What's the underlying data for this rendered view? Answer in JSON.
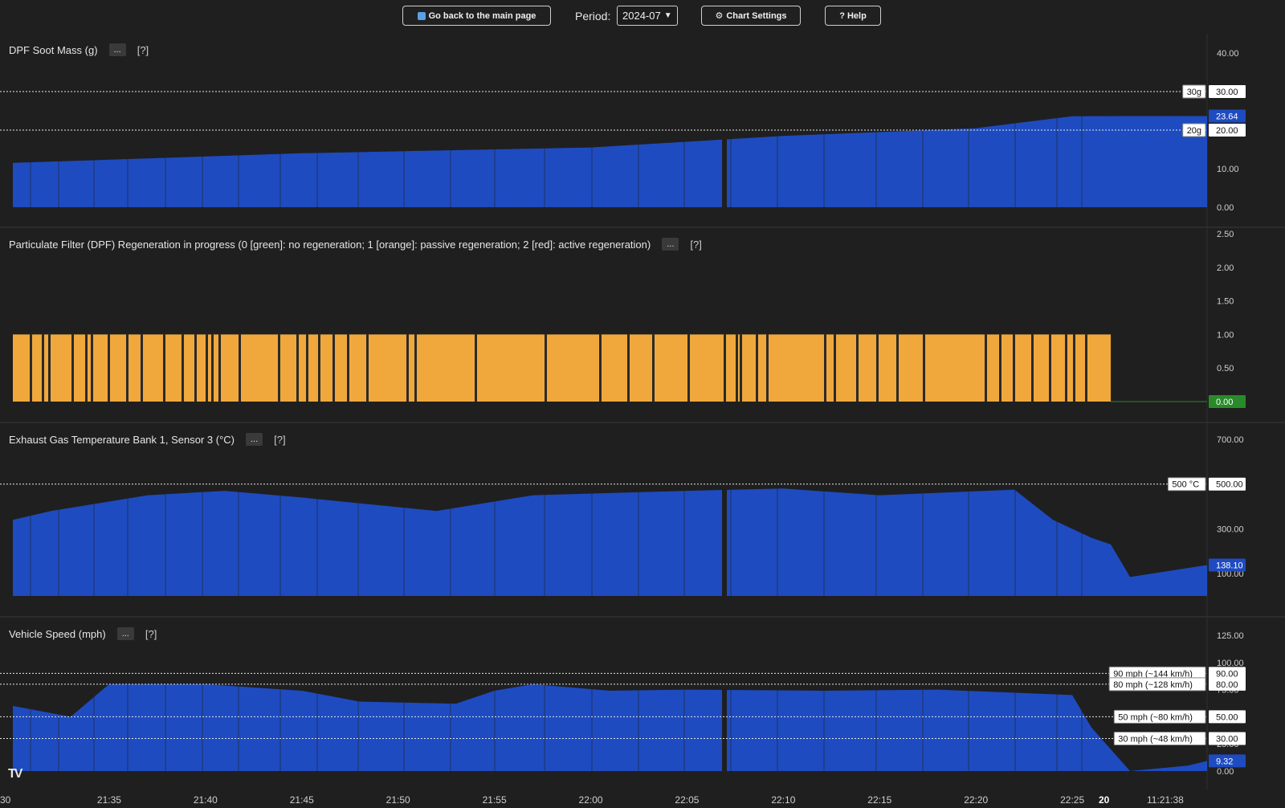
{
  "toolbar": {
    "back_label": "Go back to the main page",
    "period_label": "Period:",
    "period_value": "2024-07",
    "settings_label": "Chart Settings",
    "help_label": "? Help"
  },
  "panes": [
    {
      "title": "DPF Soot Mass (g)",
      "more": "...",
      "help": "[?]"
    },
    {
      "title": "Particulate Filter (DPF) Regeneration in progress (0 [green]: no regeneration; 1 [orange]: passive regeneration; 2 [red]: active regeneration)",
      "more": "...",
      "help": "[?]"
    },
    {
      "title": "Exhaust Gas Temperature Bank 1, Sensor 3 (°C)",
      "more": "...",
      "help": "[?]"
    },
    {
      "title": "Vehicle Speed (mph)",
      "more": "...",
      "help": "[?]"
    }
  ],
  "colors": {
    "blue": "#1e4bc0",
    "orange": "#f0a83c",
    "green": "#2a8a2a",
    "bg": "#1f1f1f"
  },
  "chart_data": [
    {
      "type": "area",
      "title": "DPF Soot Mass (g)",
      "ylim": [
        0,
        40
      ],
      "yticks": [
        "0.00",
        "10.00",
        "20.00",
        "30.00",
        "40.00"
      ],
      "x": [
        "21:30",
        "21:45",
        "22:00",
        "22:10",
        "22:20",
        "22:25",
        "22:28",
        "22:32"
      ],
      "y": [
        11.5,
        14,
        15.5,
        18.5,
        20.5,
        23.6,
        23.64,
        23.64
      ],
      "last_value": "23.64",
      "thresholds": [
        {
          "label": "30g",
          "value": 30,
          "value_label": "30.00"
        },
        {
          "label": "20g",
          "value": 20,
          "value_label": "20.00"
        }
      ]
    },
    {
      "type": "area",
      "title": "Particulate Filter (DPF) Regeneration in progress",
      "ylim": [
        0,
        2.5
      ],
      "yticks": [
        "0.00",
        "0.50",
        "1.00",
        "1.50",
        "2.00",
        "2.50"
      ],
      "x": [
        "21:30",
        "22:27",
        "22:32"
      ],
      "y": [
        1,
        1,
        0
      ],
      "last_value": "0.00"
    },
    {
      "type": "area",
      "title": "Exhaust Gas Temperature Bank 1, Sensor 3 (°C)",
      "ylim": [
        0,
        700
      ],
      "yticks": [
        "100.00",
        "300.00",
        "500.00",
        "700.00"
      ],
      "x": [
        "21:30",
        "21:32",
        "21:37",
        "21:41",
        "21:45",
        "21:52",
        "21:57",
        "22:05",
        "22:10",
        "22:15",
        "22:22",
        "22:24",
        "22:26",
        "22:27",
        "22:28",
        "22:32"
      ],
      "y": [
        340,
        380,
        450,
        470,
        440,
        380,
        450,
        470,
        480,
        450,
        475,
        340,
        260,
        230,
        85,
        138.1
      ],
      "last_value": "138.10",
      "thresholds": [
        {
          "label": "500 °C",
          "value": 500,
          "value_label": "500.00"
        }
      ]
    },
    {
      "type": "area",
      "title": "Vehicle Speed (mph)",
      "ylim": [
        0,
        125
      ],
      "yticks": [
        "0.00",
        "25.00",
        "50.00",
        "75.00",
        "100.00",
        "125.00"
      ],
      "x": [
        "21:30",
        "21:33",
        "21:35",
        "21:40",
        "21:45",
        "21:48",
        "21:53",
        "21:55",
        "21:57",
        "22:01",
        "22:05",
        "22:12",
        "22:18",
        "22:25",
        "22:26",
        "22:27",
        "22:28",
        "22:31",
        "22:32"
      ],
      "y": [
        60,
        50,
        80,
        80,
        74,
        64,
        62,
        74,
        80,
        74,
        75,
        74,
        75,
        70,
        40,
        20,
        0,
        5,
        9.32
      ],
      "last_value": "9.32",
      "thresholds": [
        {
          "label": "90 mph (~144 km/h)",
          "value": 90,
          "value_label": "90.00"
        },
        {
          "label": "80 mph (~128 km/h)",
          "value": 80,
          "value_label": "80.00"
        },
        {
          "label": "50 mph (~80 km/h)",
          "value": 50,
          "value_label": "50.00"
        },
        {
          "label": "30 mph (~48 km/h)",
          "value": 30,
          "value_label": "30.00"
        }
      ]
    }
  ],
  "x_axis": {
    "ticks": [
      "30",
      "21:35",
      "21:40",
      "21:45",
      "21:50",
      "21:55",
      "22:00",
      "22:05",
      "22:10",
      "22:15",
      "22:20",
      "22:25",
      "20",
      "11:21:38"
    ],
    "bold_ticks": [
      "20"
    ]
  },
  "logo_text": "TV"
}
